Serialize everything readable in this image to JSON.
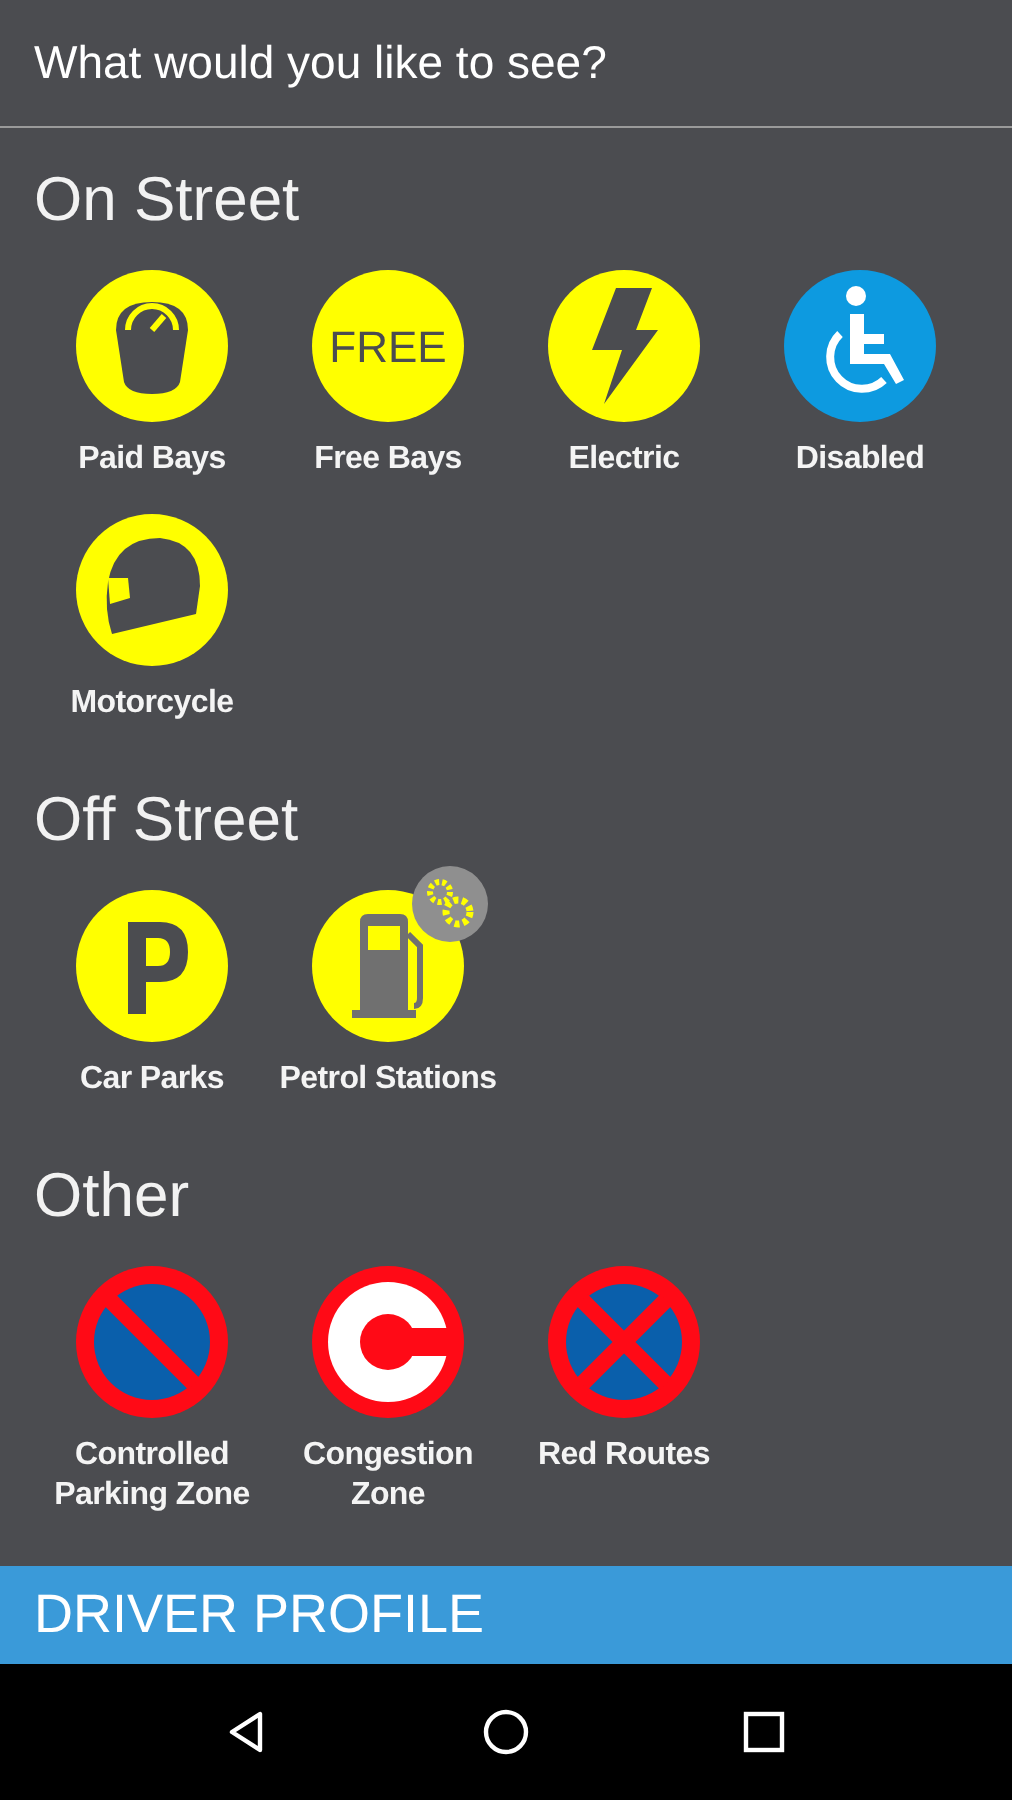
{
  "header": {
    "title": "What would you like to see?"
  },
  "sections": [
    {
      "title": "On Street",
      "items": [
        {
          "label": "Paid Bays",
          "kind": "meter",
          "badge": false
        },
        {
          "label": "Free Bays",
          "kind": "text",
          "icon_text": "FREE",
          "badge": false
        },
        {
          "label": "Electric",
          "kind": "bolt",
          "badge": false
        },
        {
          "label": "Disabled",
          "kind": "wheelchair",
          "badge": false
        },
        {
          "label": "Motorcycle",
          "kind": "helmet",
          "badge": false
        }
      ]
    },
    {
      "title": "Off Street",
      "items": [
        {
          "label": "Car Parks",
          "kind": "parking",
          "badge": false
        },
        {
          "label": "Petrol Stations",
          "kind": "fuel",
          "badge": true
        }
      ]
    },
    {
      "title": "Other",
      "items": [
        {
          "label": "Controlled Parking Zone",
          "kind": "no-waiting",
          "badge": false
        },
        {
          "label": "Congestion Zone",
          "kind": "congestion",
          "badge": false
        },
        {
          "label": "Red Routes",
          "kind": "clearway",
          "badge": false
        }
      ]
    }
  ],
  "footer": {
    "label": "DRIVER PROFILE"
  }
}
